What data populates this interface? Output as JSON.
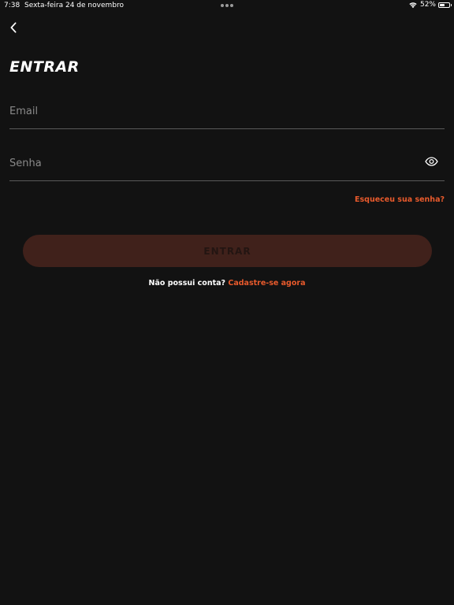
{
  "status_bar": {
    "time": "7:38",
    "date": "Sexta-feira 24 de novembro",
    "battery": "52%",
    "battery_level": 0.52
  },
  "header": {
    "title": "ENTRAR"
  },
  "form": {
    "email_placeholder": "Email",
    "email_value": "",
    "password_placeholder": "Senha",
    "password_value": "",
    "forgot_password": "Esqueceu sua senha?",
    "submit_label": "ENTRAR"
  },
  "footer": {
    "prompt": "Não possui conta?",
    "signup_link": "Cadastre-se agora"
  },
  "colors": {
    "background": "#121212",
    "accent": "#e85a2c",
    "button_disabled": "#40211b"
  },
  "icons": {
    "back": "chevron-left-icon",
    "password_toggle": "eye-icon",
    "wifi": "wifi-icon",
    "battery": "battery-icon"
  }
}
